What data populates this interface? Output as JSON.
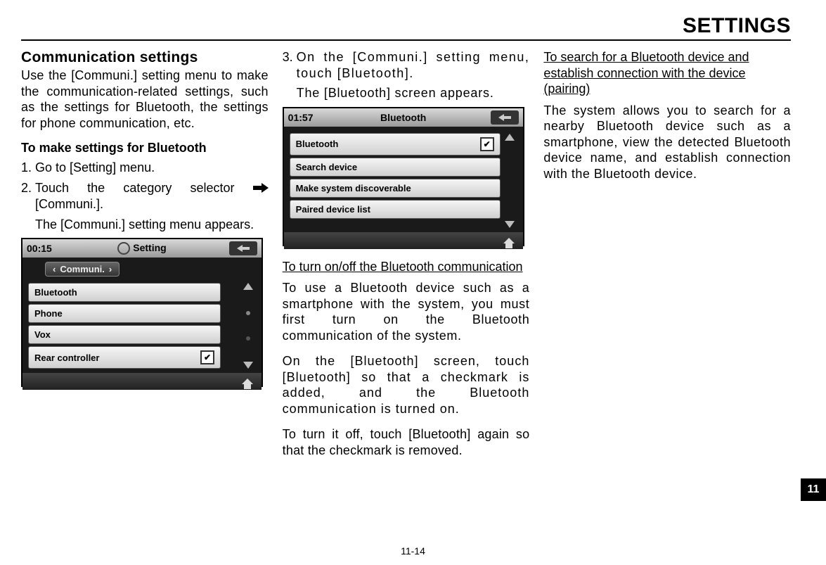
{
  "header": {
    "title": "SETTINGS"
  },
  "col1": {
    "heading": "Communication settings",
    "intro": "Use the [Communi.] setting menu to make the communication-related settings, such as the settings for Bluetooth, the settings for phone communication, etc.",
    "bt_heading": "To make settings for Bluetooth",
    "step1": "Go to [Setting] menu.",
    "step2_a": "Touch the category selector ",
    "step2_b": " [Communi.].",
    "step2_sub": "The [Communi.] setting menu appears."
  },
  "screen1": {
    "time": "00:15",
    "title": "Setting",
    "tab": "Communi.",
    "rows": [
      "Bluetooth",
      "Phone",
      "Vox",
      "Rear controller"
    ]
  },
  "col2": {
    "step3": "On the [Communi.] setting menu, touch [Bluetooth].",
    "step3_sub": "The [Bluetooth] screen appears.",
    "turn_heading": "To turn on/off the Bluetooth communication",
    "turn_p1": "To use a Bluetooth device such as a smartphone with the system, you must first turn on the Bluetooth communication of the system.",
    "turn_p2": "On the [Bluetooth] screen, touch [Bluetooth] so that a checkmark is added, and the Bluetooth communication is turned on.",
    "turn_p3": "To turn it off, touch [Bluetooth] again so that the checkmark is removed."
  },
  "screen2": {
    "time": "01:57",
    "title": "Bluetooth",
    "rows": [
      "Bluetooth",
      "Search device",
      "Make system discoverable",
      "Paired device list"
    ]
  },
  "col3": {
    "search_heading": "To search for a Bluetooth device and establish connection with the device (pairing)",
    "search_p1": "The system allows you to search for a nearby Bluetooth device such as a smartphone, view the detected Bluetooth device name, and establish connection with the Bluetooth device."
  },
  "footer": {
    "page": "11-14",
    "tab": "11"
  }
}
